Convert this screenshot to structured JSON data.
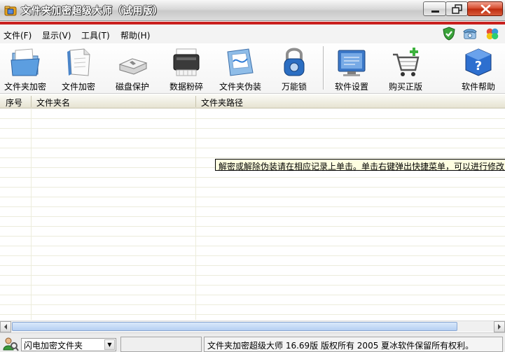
{
  "window": {
    "title": "文件夹加密超级大师（试用版）"
  },
  "menu": {
    "items": [
      {
        "label": "文件(F)"
      },
      {
        "label": "显示(V)"
      },
      {
        "label": "工具(T)"
      },
      {
        "label": "帮助(H)"
      }
    ]
  },
  "toolbar": {
    "items": [
      {
        "label": "文件夹加密",
        "icon": "folder-encrypt-icon"
      },
      {
        "label": "文件加密",
        "icon": "file-encrypt-icon"
      },
      {
        "label": "磁盘保护",
        "icon": "disk-protect-icon"
      },
      {
        "label": "数据粉碎",
        "icon": "data-shred-icon"
      },
      {
        "label": "文件夹伪装",
        "icon": "folder-disguise-icon"
      },
      {
        "label": "万能锁",
        "icon": "padlock-icon"
      },
      {
        "label": "软件设置",
        "icon": "settings-icon"
      },
      {
        "label": "购买正版",
        "icon": "shopping-cart-icon"
      },
      {
        "label": "软件帮助",
        "icon": "help-icon"
      }
    ]
  },
  "table": {
    "columns": [
      "序号",
      "文件夹名",
      "文件夹路径"
    ],
    "rows": []
  },
  "tooltip": "解密或解除伪装请在相应记录上单击。单击右键弹出快捷菜单，可以进行修改",
  "statusbar": {
    "mode_select": "闪电加密文件夹",
    "copyright": "文件夹加密超级大师 16.69版 版权所有 2005 夏冰软件保留所有权利。"
  },
  "colors": {
    "accent": "#c9201e",
    "close_button": "#c8321a",
    "scroll_thumb": "#b6cff2"
  }
}
